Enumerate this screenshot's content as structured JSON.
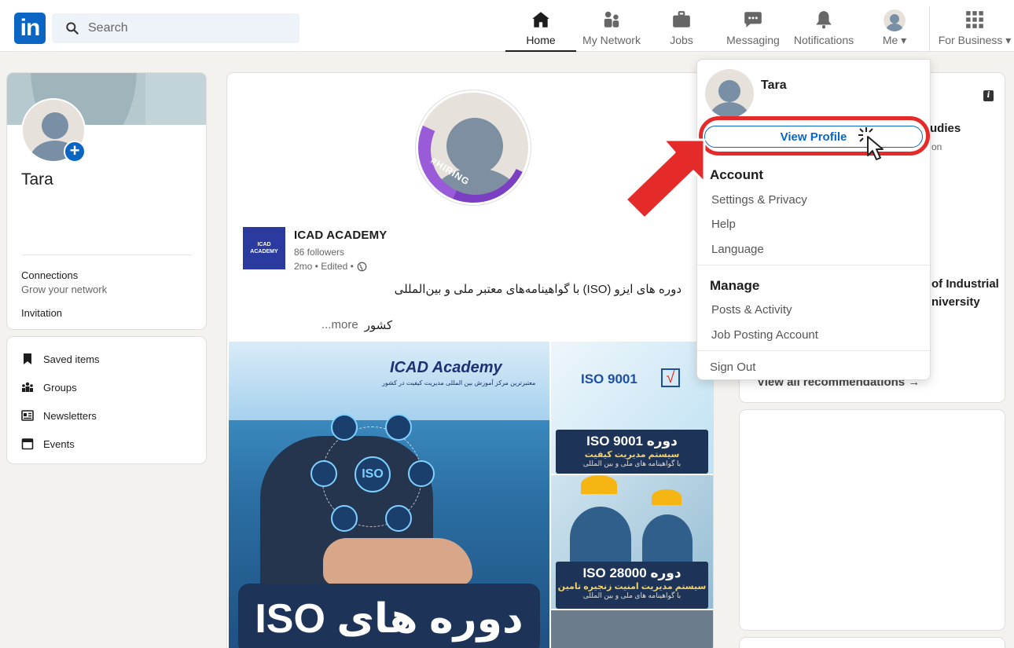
{
  "nav": {
    "logo": "in",
    "search_placeholder": "Search",
    "items": [
      {
        "label": "Home"
      },
      {
        "label": "My Network"
      },
      {
        "label": "Jobs"
      },
      {
        "label": "Messaging"
      },
      {
        "label": "Notifications"
      },
      {
        "label": "Me ▾"
      },
      {
        "label": "For Business ▾"
      }
    ]
  },
  "profile_card": {
    "name": "Tara",
    "connections_title": "Connections",
    "connections_sub": "Grow your network",
    "invitation": "Invitation"
  },
  "links": [
    {
      "label": "Saved items"
    },
    {
      "label": "Groups"
    },
    {
      "label": "Newsletters"
    },
    {
      "label": "Events"
    }
  ],
  "post": {
    "hiring_badge": "#HIRING",
    "company_logo_text": "ICAD ACADEMY",
    "company": "ICAD ACADEMY",
    "followers": "86 followers",
    "time": "2mo • Edited •",
    "text_line1": "دوره های ایزو (ISO) با گواهینامه‌های معتبر ملی و بین‌المللی",
    "text_line2": "کشور",
    "more": "...more",
    "img_brand": "ICAD Academy",
    "img_brand_sub": "معتبرترین مرکز آموزش بین المللی مدیریت کیفیت در کشور",
    "iso_center": "ISO",
    "iso_banner": "دوره های ISO",
    "r1_tag": "ISO 9001",
    "r1_check": "√",
    "r1_title": "دوره ISO 9001",
    "r1_sub": "سیستم مدیریت کیفیت",
    "r1_note": "با گواهینامه های ملی و بین المللی",
    "r2_title": "دوره ISO 28000",
    "r2_sub": "سیستم مدیریت امنیت زنجیره تامین",
    "r2_note": "با گواهینامه های ملی و بین المللی"
  },
  "right": {
    "frag1": "udies",
    "frag1_sub": "on",
    "frag2": "of Industrial",
    "frag3": "niversity",
    "view_all": "View all recommendations →"
  },
  "dropdown": {
    "name": "Tara",
    "view_profile": "View Profile",
    "account_heading": "Account",
    "account_items": [
      "Settings & Privacy",
      "Help",
      "Language"
    ],
    "manage_heading": "Manage",
    "manage_items": [
      "Posts & Activity",
      "Job Posting Account"
    ],
    "sign_out": "Sign Out"
  },
  "colors": {
    "brand": "#0a66c2",
    "highlight": "#e52a2a",
    "hiring": "#7b3fc4"
  }
}
